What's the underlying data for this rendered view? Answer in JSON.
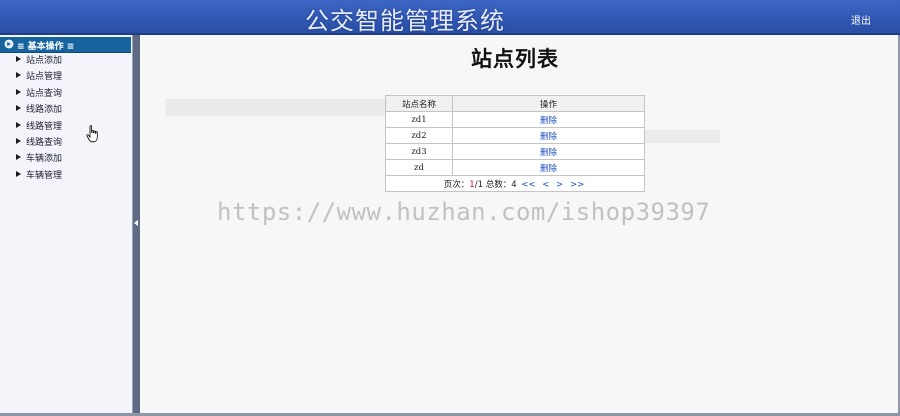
{
  "header": {
    "title": "公交智能管理系统",
    "logout_label": "退出"
  },
  "sidebar": {
    "group_title": "≡ 基本操作 ≡",
    "items": [
      {
        "label": "站点添加"
      },
      {
        "label": "站点管理"
      },
      {
        "label": "站点查询"
      },
      {
        "label": "线路添加"
      },
      {
        "label": "线路管理"
      },
      {
        "label": "线路查询"
      },
      {
        "label": "车辆添加"
      },
      {
        "label": "车辆管理"
      }
    ]
  },
  "main": {
    "page_title": "站点列表",
    "table": {
      "columns": [
        "站点名称",
        "操作"
      ],
      "rows": [
        {
          "name": "zd1",
          "action": "删除"
        },
        {
          "name": "zd2",
          "action": "删除"
        },
        {
          "name": "zd3",
          "action": "删除"
        },
        {
          "name": "zd",
          "action": "删除"
        }
      ]
    },
    "pager": {
      "page_label": "页次：",
      "current_page": "1",
      "total_pages_text": "/1",
      "total_label": "总数：",
      "total_count": "4",
      "first": "<<",
      "prev": "<",
      "next": ">",
      "last": ">>"
    }
  },
  "watermark": "https://www.huzhan.com/ishop39397",
  "colors": {
    "header_bg": "#3158b4",
    "menu_header_bg": "#17639e",
    "link": "#1c4fc2",
    "current_page": "#d01414"
  }
}
